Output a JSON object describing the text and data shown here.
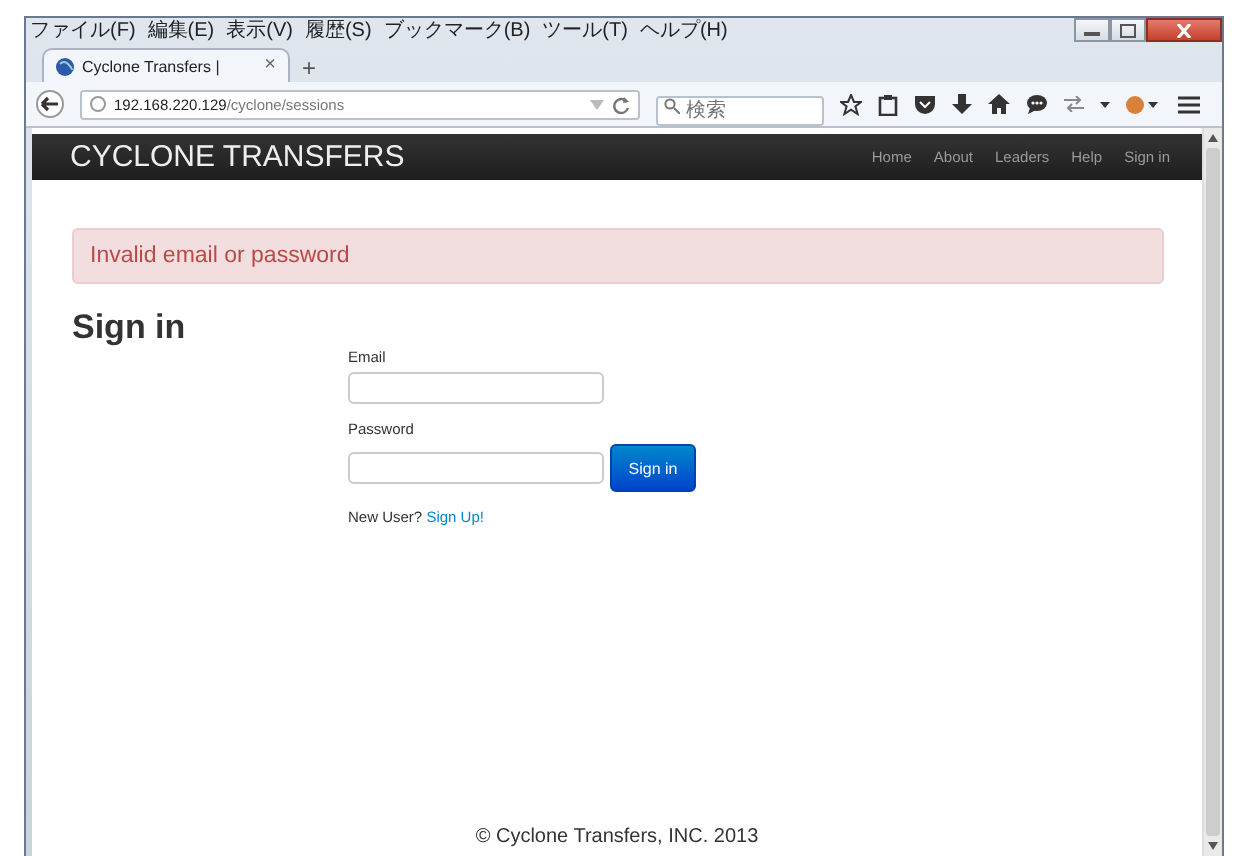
{
  "menu_bar": [
    "ファイル(F)",
    "編集(E)",
    "表示(V)",
    "履歴(S)",
    "ブックマーク(B)",
    "ツール(T)",
    "ヘルプ(H)"
  ],
  "tab": {
    "title": "Cyclone Transfers |",
    "close": "×",
    "new_tab": "+"
  },
  "address_bar": {
    "host": "192.168.220.129",
    "path": "/cyclone/sessions"
  },
  "search": {
    "placeholder": "検索"
  },
  "site": {
    "brand": "CYCLONE TRANSFERS",
    "nav": [
      {
        "label": "Home"
      },
      {
        "label": "About"
      },
      {
        "label": "Leaders"
      },
      {
        "label": "Help"
      },
      {
        "label": "Sign in"
      }
    ]
  },
  "alert": "Invalid email or password",
  "form": {
    "heading": "Sign in",
    "fields": [
      {
        "label": "Email"
      },
      {
        "label": "Password"
      }
    ],
    "submit": "Sign in",
    "signup_prompt": "New User?",
    "signup_link": "Sign Up!"
  },
  "footer": "© Cyclone Transfers, INC. 2013"
}
